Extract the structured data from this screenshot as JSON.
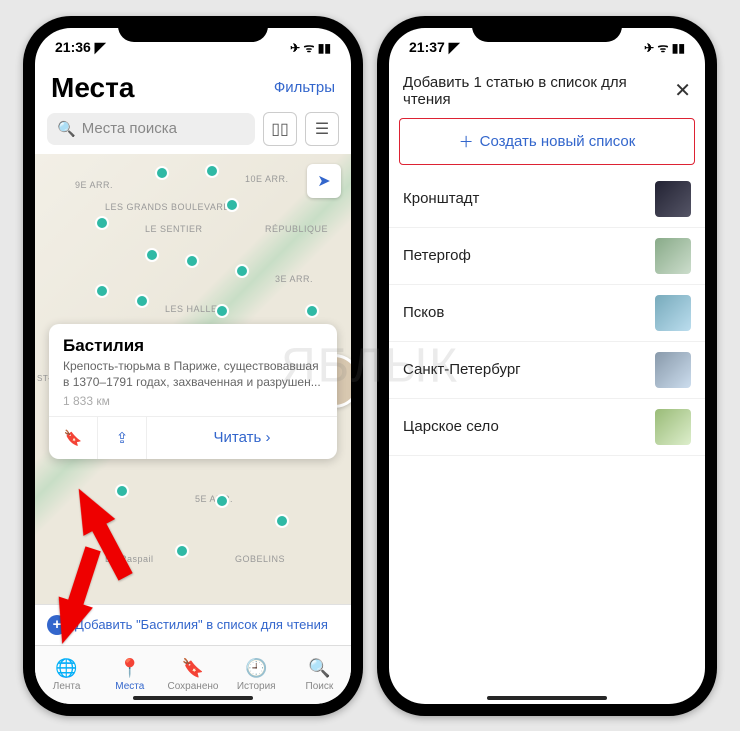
{
  "watermark": "ЯБЛЫК",
  "left": {
    "status_time": "21:36",
    "header_title": "Места",
    "filters_label": "Фильтры",
    "search_placeholder": "Места поиска",
    "map_labels": [
      "9E ARR.",
      "10E ARR.",
      "LES GRANDS BOULEVARDS",
      "LE SENTIER",
      "RÉPUBLIQUE",
      "3E ARR.",
      "LES HALLES",
      "ST-GERMAIN-DES-PRÉS",
      "5E ARR.",
      "Bd Raspail",
      "GOBELINS"
    ],
    "card": {
      "title": "Бастилия",
      "description": "Крепость-тюрьма в Париже, существовавшая в 1370–1791 годах, захваченная и разрушен...",
      "distance": "1 833 км",
      "read_label": "Читать"
    },
    "add_banner": "Добавить \"Бастилия\" в список для чтения",
    "tabs": [
      {
        "label": "Лента"
      },
      {
        "label": "Места"
      },
      {
        "label": "Сохранено"
      },
      {
        "label": "История"
      },
      {
        "label": "Поиск"
      }
    ]
  },
  "right": {
    "status_time": "21:37",
    "sheet_title": "Добавить 1 статью в список для чтения",
    "create_label": "Создать новый список",
    "items": [
      {
        "label": "Кронштадт"
      },
      {
        "label": "Петергоф"
      },
      {
        "label": "Псков"
      },
      {
        "label": "Санкт-Петербург"
      },
      {
        "label": "Царское село"
      }
    ]
  }
}
